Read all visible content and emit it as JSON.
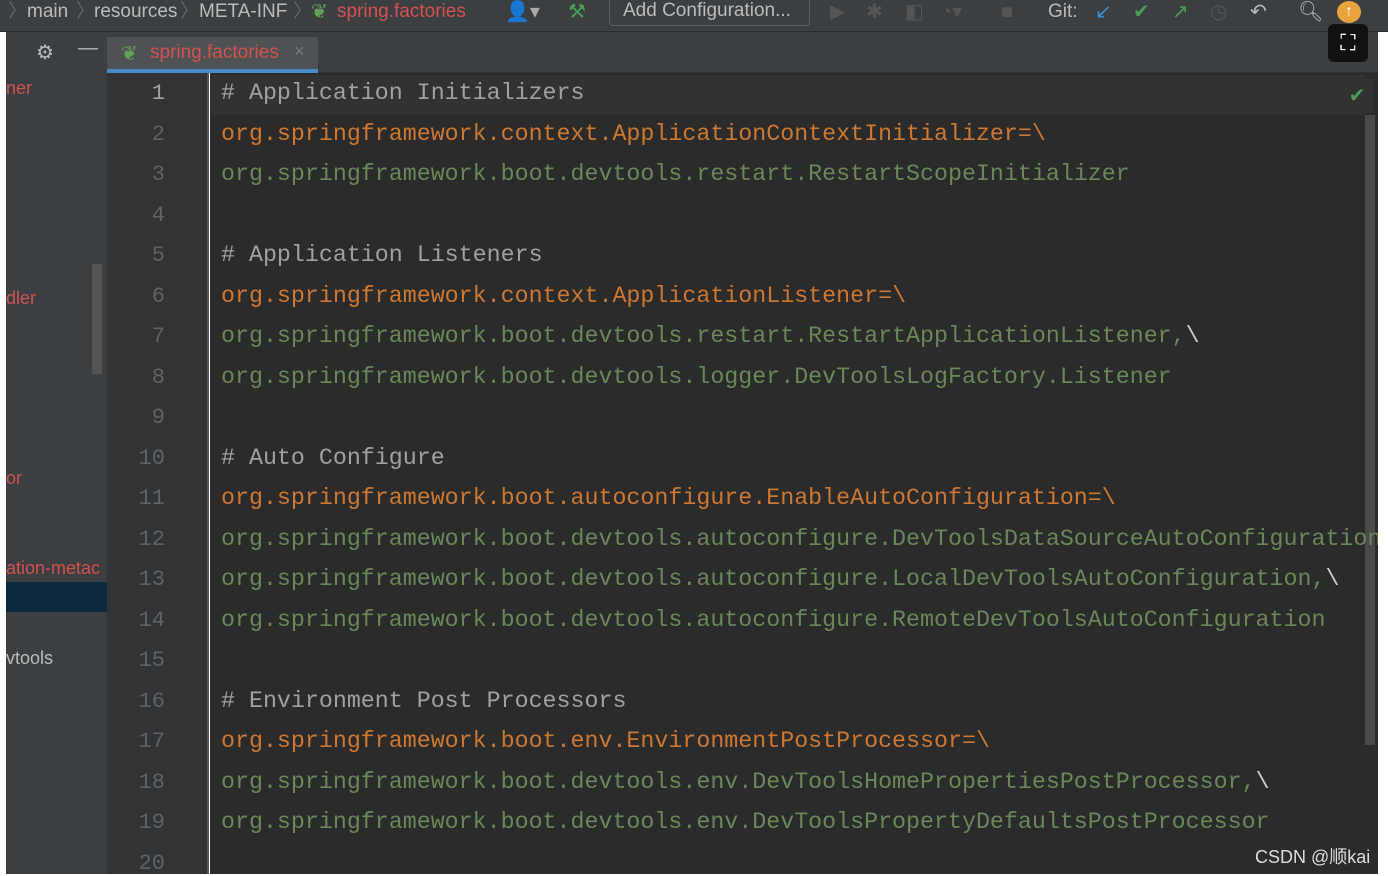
{
  "breadcrumbs": [
    "main",
    "resources",
    "META-INF",
    "spring.factories"
  ],
  "toolbar": {
    "add_configuration": "Add Configuration...",
    "git_label": "Git:"
  },
  "tab": {
    "label": "spring.factories",
    "close": "×"
  },
  "sidebar": {
    "items": [
      {
        "label": "ner",
        "color": "#d25252"
      },
      {
        "label": "dler",
        "color": "#d25252"
      },
      {
        "label": "or",
        "color": "#d25252"
      },
      {
        "label": "ation-metac",
        "color": "#d25252"
      },
      {
        "label": "vtools",
        "color": "#bbbbbb"
      }
    ]
  },
  "colors": {
    "key": "#cc7832",
    "value": "#6a8759",
    "comment": "#a0a0a0",
    "background": "#2b2b2b",
    "tab_underline": "#4a88c7"
  },
  "editor": {
    "lines": [
      {
        "n": "1",
        "type": "comment",
        "text": "# Application Initializers"
      },
      {
        "n": "2",
        "type": "key",
        "text": "org.springframework.context.ApplicationContextInitializer",
        "suffix": "=\\"
      },
      {
        "n": "3",
        "type": "val",
        "text": "org.springframework.boot.devtools.restart.RestartScopeInitializer"
      },
      {
        "n": "4",
        "type": "blank",
        "text": ""
      },
      {
        "n": "5",
        "type": "comment",
        "text": "# Application Listeners"
      },
      {
        "n": "6",
        "type": "key",
        "text": "org.springframework.context.ApplicationListener",
        "suffix": "=\\"
      },
      {
        "n": "7",
        "type": "val",
        "text": "org.springframework.boot.devtools.restart.RestartApplicationListener,",
        "suffix": "\\"
      },
      {
        "n": "8",
        "type": "val",
        "text": "org.springframework.boot.devtools.logger.DevToolsLogFactory.Listener"
      },
      {
        "n": "9",
        "type": "blank",
        "text": ""
      },
      {
        "n": "10",
        "type": "comment",
        "text": "# Auto Configure"
      },
      {
        "n": "11",
        "type": "key",
        "text": "org.springframework.boot.autoconfigure.EnableAutoConfiguration",
        "suffix": "=\\"
      },
      {
        "n": "12",
        "type": "val",
        "text": "org.springframework.boot.devtools.autoconfigure.DevToolsDataSourceAutoConfiguration,\\"
      },
      {
        "n": "13",
        "type": "val",
        "text": "org.springframework.boot.devtools.autoconfigure.LocalDevToolsAutoConfiguration,",
        "suffix": "\\"
      },
      {
        "n": "14",
        "type": "val",
        "text": "org.springframework.boot.devtools.autoconfigure.RemoteDevToolsAutoConfiguration"
      },
      {
        "n": "15",
        "type": "blank",
        "text": ""
      },
      {
        "n": "16",
        "type": "comment",
        "text": "# Environment Post Processors"
      },
      {
        "n": "17",
        "type": "key",
        "text": "org.springframework.boot.env.EnvironmentPostProcessor",
        "suffix": "=\\"
      },
      {
        "n": "18",
        "type": "val",
        "text": "org.springframework.boot.devtools.env.DevToolsHomePropertiesPostProcessor,",
        "suffix": "\\"
      },
      {
        "n": "19",
        "type": "val",
        "text": "org.springframework.boot.devtools.env.DevToolsPropertyDefaultsPostProcessor"
      },
      {
        "n": "20",
        "type": "blank",
        "text": ""
      }
    ]
  },
  "watermark": "CSDN @顺kai"
}
